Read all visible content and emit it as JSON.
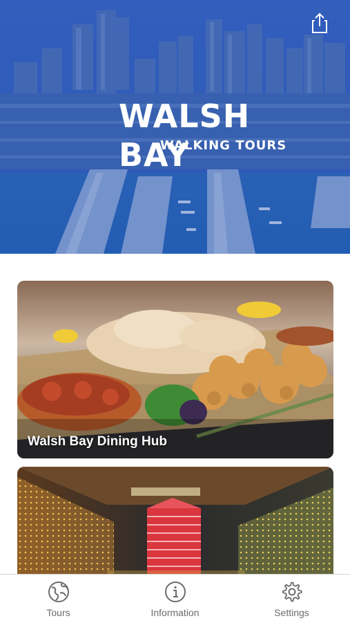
{
  "hero": {
    "title": "WALSH BAY",
    "subtitle": "WALKING TOURS"
  },
  "cards": [
    {
      "title": "Walsh Bay Dining Hub"
    },
    {
      "title": ""
    }
  ],
  "tabbar": {
    "items": [
      {
        "label": "Tours",
        "icon": "globe-map-icon"
      },
      {
        "label": "Information",
        "icon": "info-icon"
      },
      {
        "label": "Settings",
        "icon": "gear-icon"
      }
    ]
  },
  "colors": {
    "hero_tint": "#2a55b0",
    "tab_label": "#6b6b6b",
    "tab_icon": "#6b6b6b"
  }
}
